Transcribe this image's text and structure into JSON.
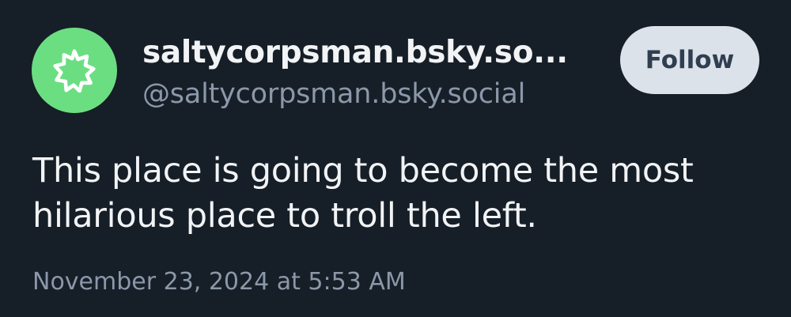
{
  "author": {
    "display_name": "saltycorpsman.bsky.so...",
    "handle": "@saltycorpsman.bsky.social",
    "avatar_icon": "starburst-icon",
    "avatar_color": "#6bde82"
  },
  "actions": {
    "follow_label": "Follow"
  },
  "post": {
    "text": "This place is going to become the most hilarious place to troll the left.",
    "timestamp": "November 23, 2024 at 5:53 AM"
  },
  "theme": {
    "background": "#161e27",
    "text_primary": "#f1f3f5",
    "text_secondary": "#8b98a9",
    "button_bg": "#dce2ea",
    "button_text": "#2f3e50"
  }
}
